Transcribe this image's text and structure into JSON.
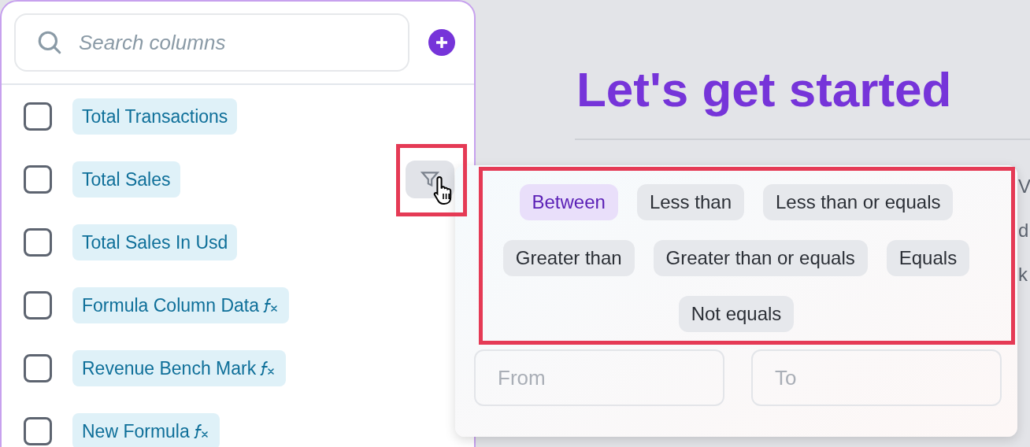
{
  "sidebar": {
    "search": {
      "placeholder": "Search columns"
    },
    "columns": [
      {
        "label": "Total Transactions",
        "checked": false,
        "formula": false,
        "filter_button": false
      },
      {
        "label": "Total Sales",
        "checked": false,
        "formula": false,
        "filter_button": true
      },
      {
        "label": "Total Sales In Usd",
        "checked": false,
        "formula": false,
        "filter_button": false
      },
      {
        "label": "Formula Column Data",
        "checked": false,
        "formula": true,
        "filter_button": false
      },
      {
        "label": "Revenue Bench Mark",
        "checked": false,
        "formula": true,
        "filter_button": false
      },
      {
        "label": "New Formula",
        "checked": false,
        "formula": true,
        "filter_button": false
      }
    ]
  },
  "main": {
    "heading": "Let's get started",
    "cut_text": [
      "V",
      "d",
      "k"
    ]
  },
  "filter_popover": {
    "operators": [
      {
        "label": "Between",
        "selected": true
      },
      {
        "label": "Less than",
        "selected": false
      },
      {
        "label": "Less than or equals",
        "selected": false
      },
      {
        "label": "Greater than",
        "selected": false
      },
      {
        "label": "Greater than or equals",
        "selected": false
      },
      {
        "label": "Equals",
        "selected": false
      },
      {
        "label": "Not equals",
        "selected": false
      }
    ],
    "from": {
      "placeholder": "From"
    },
    "to": {
      "placeholder": "To"
    }
  }
}
